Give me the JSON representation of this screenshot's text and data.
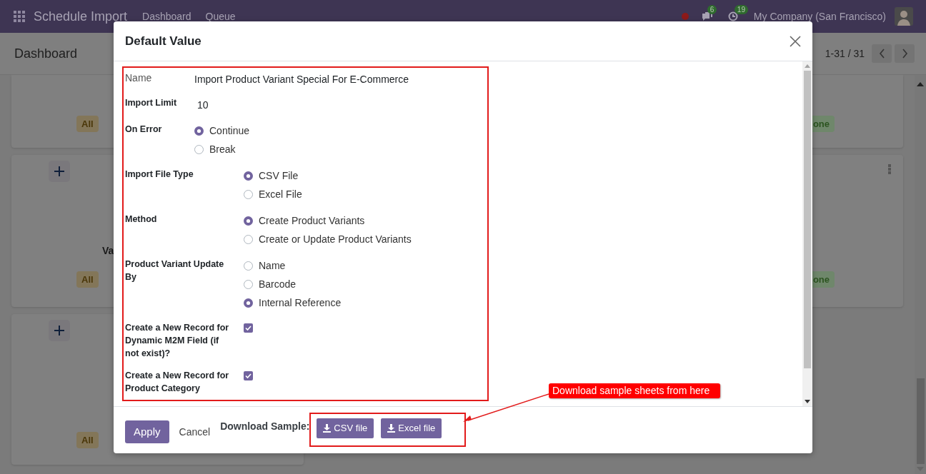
{
  "navbar": {
    "app_title": "Schedule Import",
    "menu": [
      {
        "label": "Dashboard"
      },
      {
        "label": "Queue"
      }
    ],
    "message_count": "6",
    "activity_count": "19",
    "company": "My Company (San Francisco)"
  },
  "control_panel": {
    "title": "Dashboard",
    "pager": "1-31 / 31"
  },
  "kanban": {
    "columns": [
      {
        "cards": [
          {
            "tag": {
              "label": "All",
              "color": "#837659"
            }
          },
          {
            "title": "Va",
            "tag": {
              "label": "All",
              "color": "#837659"
            }
          },
          {
            "tag": {
              "label": "All",
              "color": "#837659"
            }
          }
        ]
      },
      {
        "cards": [
          {
            "tag": {
              "label": "one",
              "color": "#6f876b"
            }
          },
          {
            "tag": {
              "label": "one",
              "color": "#6f876b"
            }
          }
        ]
      }
    ]
  },
  "dialog": {
    "title": "Default Value",
    "groups": [
      {
        "fields": [
          {
            "kind": "readonly",
            "label": "Name",
            "value": "Import Product Variant Special For E-Commerce"
          },
          {
            "kind": "input",
            "label": "Import Limit",
            "value": "10"
          },
          {
            "kind": "radio",
            "label": "On Error",
            "options": [
              {
                "label": "Continue",
                "selected": true
              },
              {
                "label": "Break",
                "selected": false
              }
            ]
          }
        ]
      },
      {
        "fields": [
          {
            "kind": "radio",
            "label": "Import File Type",
            "options": [
              {
                "label": "CSV File",
                "selected": true
              },
              {
                "label": "Excel File",
                "selected": false
              }
            ]
          },
          {
            "kind": "radio",
            "label": "Method",
            "options": [
              {
                "label": "Create Product Variants",
                "selected": true
              },
              {
                "label": "Create or Update Product Variants",
                "selected": false
              }
            ]
          },
          {
            "kind": "radio",
            "label": "Product Variant Update By",
            "options": [
              {
                "label": "Name",
                "selected": false
              },
              {
                "label": "Barcode",
                "selected": false
              },
              {
                "label": "Internal Reference",
                "selected": true
              }
            ]
          },
          {
            "kind": "checkbox",
            "label": "Create a New Record for Dynamic M2M Field (if not exist)?",
            "checked": true
          },
          {
            "kind": "checkbox",
            "label": "Create a New Record for Product Category",
            "checked": true
          }
        ]
      }
    ],
    "buttons": [
      {
        "label": "Apply",
        "kind": "primary"
      },
      {
        "label": "Cancel",
        "kind": "link"
      }
    ],
    "download": {
      "label": "Download Sample:",
      "files": [
        {
          "label": "CSV file"
        },
        {
          "label": "Excel file"
        }
      ]
    }
  },
  "annotation": {
    "callout": "Download sample sheets from here"
  }
}
